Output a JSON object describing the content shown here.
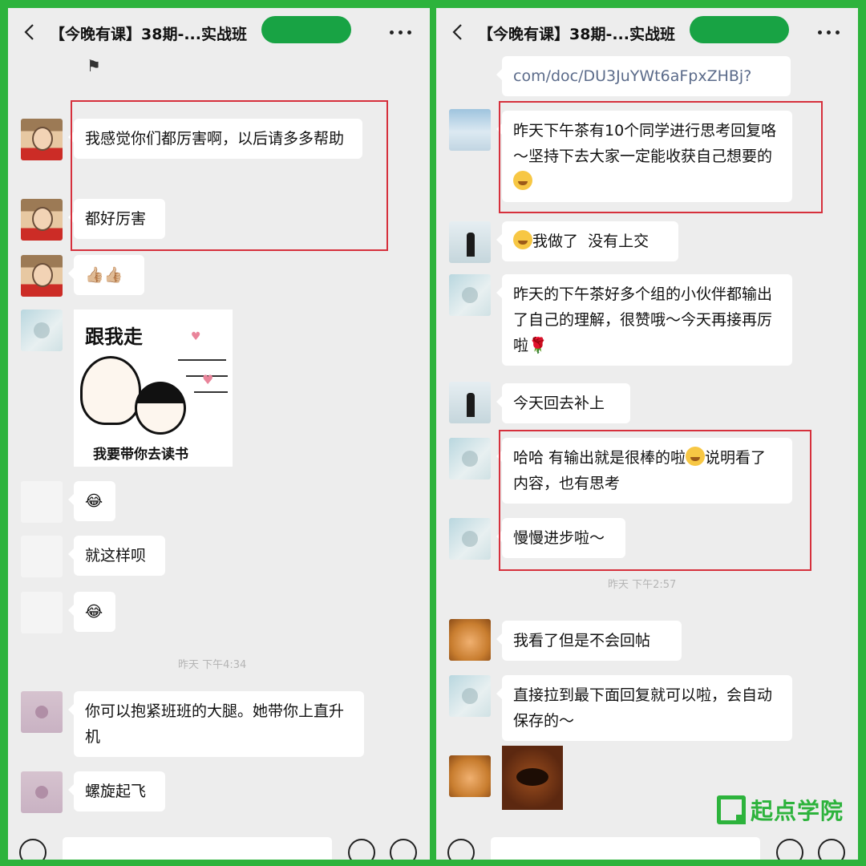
{
  "left": {
    "title": "【今晚有课】38期-...实战班",
    "messages": [
      {
        "text": "我感觉你们都厉害啊，以后请多多帮助"
      },
      {
        "text": "都好厉害"
      },
      {
        "text": "👍🏼👍🏼"
      },
      {
        "text": "😂"
      },
      {
        "text": "就这样呗"
      },
      {
        "text": "😂"
      },
      {
        "text": "你可以抱紧班班的大腿。她带你上直升机"
      },
      {
        "text": "螺旋起飞"
      }
    ],
    "sticker": {
      "top_text": "跟我走",
      "bottom_text": "我要带你去读书"
    },
    "time": "昨天 下午4:34"
  },
  "right": {
    "title": "【今晚有课】38期-...实战班",
    "messages": [
      {
        "text": "com/doc/DU3JuYWt6aFpxZHBj?"
      },
      {
        "text": "昨天下午茶有10个同学进行思考回复咯～坚持下去大家一定能收获自己想要的"
      },
      {
        "text": "我做了  没有上交"
      },
      {
        "text": "昨天的下午茶好多个组的小伙伴都输出了自己的理解，很赞哦～今天再接再厉啦🌹"
      },
      {
        "text": "今天回去补上"
      },
      {
        "text": "哈哈 有输出就是很棒的啦"
      },
      {
        "text": "说明看了内容，也有思考"
      },
      {
        "text": "慢慢进步啦～"
      },
      {
        "text": "我看了但是不会回帖"
      },
      {
        "text": "直接拉到最下面回复就可以啦，会自动保存的～"
      }
    ],
    "time": "昨天 下午2:57",
    "watermark": "起点学院"
  },
  "icons": {
    "back": "chevron-left-icon",
    "more": "more-dots-icon",
    "voice": "voice-icon",
    "emoji": "emoji-icon",
    "plus": "plus-icon"
  },
  "colors": {
    "frame": "#2db33c",
    "highlight": "#d6303c",
    "redact": "#18a344"
  }
}
